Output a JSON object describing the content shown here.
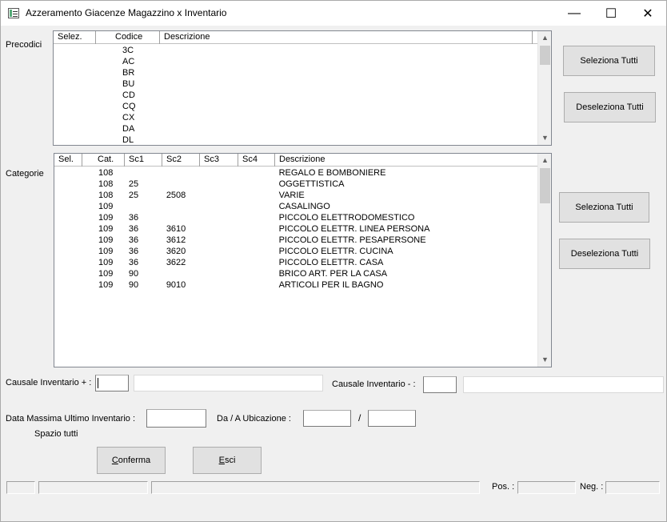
{
  "window": {
    "title": "Azzeramento Giacenze Magazzino x Inventario",
    "minimize": "—",
    "maximize": "☐",
    "close": "✕"
  },
  "precodici": {
    "label": "Precodici",
    "columns": [
      "Selez.",
      "Codice",
      "Descrizione"
    ],
    "rows": [
      {
        "sel": "",
        "codice": "3C",
        "descr": ""
      },
      {
        "sel": "",
        "codice": "AC",
        "descr": ""
      },
      {
        "sel": "",
        "codice": "BR",
        "descr": ""
      },
      {
        "sel": "",
        "codice": "BU",
        "descr": ""
      },
      {
        "sel": "",
        "codice": "CD",
        "descr": ""
      },
      {
        "sel": "",
        "codice": "CQ",
        "descr": ""
      },
      {
        "sel": "",
        "codice": "CX",
        "descr": ""
      },
      {
        "sel": "",
        "codice": "DA",
        "descr": ""
      },
      {
        "sel": "",
        "codice": "DL",
        "descr": ""
      }
    ],
    "select_all": "Seleziona Tutti",
    "deselect_all": "Deseleziona Tutti"
  },
  "categorie": {
    "label": "Categorie",
    "columns": [
      "Sel.",
      "Cat.",
      "Sc1",
      "Sc2",
      "Sc3",
      "Sc4",
      "Descrizione"
    ],
    "rows": [
      [
        "",
        "108",
        "",
        "",
        "",
        "",
        "REGALO E BOMBONIERE"
      ],
      [
        "",
        "108",
        "25",
        "",
        "",
        "",
        "OGGETTISTICA"
      ],
      [
        "",
        "108",
        "25",
        "2508",
        "",
        "",
        "VARIE"
      ],
      [
        "",
        "109",
        "",
        "",
        "",
        "",
        "CASALINGO"
      ],
      [
        "",
        "109",
        "36",
        "",
        "",
        "",
        "PICCOLO ELETTRODOMESTICO"
      ],
      [
        "",
        "109",
        "36",
        "3610",
        "",
        "",
        "PICCOLO ELETTR. LINEA PERSONA"
      ],
      [
        "",
        "109",
        "36",
        "3612",
        "",
        "",
        "PICCOLO ELETTR. PESAPERSONE"
      ],
      [
        "",
        "109",
        "36",
        "3620",
        "",
        "",
        "PICCOLO ELETTR. CUCINA"
      ],
      [
        "",
        "109",
        "36",
        "3622",
        "",
        "",
        "PICCOLO ELETTR. CASA"
      ],
      [
        "",
        "109",
        "90",
        "",
        "",
        "",
        "BRICO ART. PER LA CASA"
      ],
      [
        "",
        "109",
        "90",
        "9010",
        "",
        "",
        "ARTICOLI PER IL BAGNO"
      ]
    ],
    "select_all": "Seleziona Tutti",
    "deselect_all": "Deseleziona Tutti"
  },
  "form": {
    "causale_plus_label": "Causale Inventario + :",
    "causale_plus_code": "",
    "causale_plus_desc": "",
    "causale_minus_label": "Causale Inventario - :",
    "causale_minus_code": "",
    "causale_minus_desc": "",
    "data_label": "Data Massima Ultimo Inventario :",
    "data_value": "",
    "hint": "Spazio tutti",
    "ubicazione_label": "Da / A Ubicazione :",
    "ubicazione_sep": "/",
    "ubicazione_da": "",
    "ubicazione_a": ""
  },
  "actions": {
    "confirm_first": "C",
    "confirm_rest": "onferma",
    "exit_first": "E",
    "exit_rest": "sci"
  },
  "statusbar": {
    "pos_label": "Pos. :",
    "neg_label": "Neg. :",
    "field1": "",
    "field2": "",
    "field3": "",
    "pos_value": "",
    "neg_value": ""
  },
  "icons": {
    "app": "window-app-icon",
    "scroll_up": "▲",
    "scroll_down": "▼"
  }
}
